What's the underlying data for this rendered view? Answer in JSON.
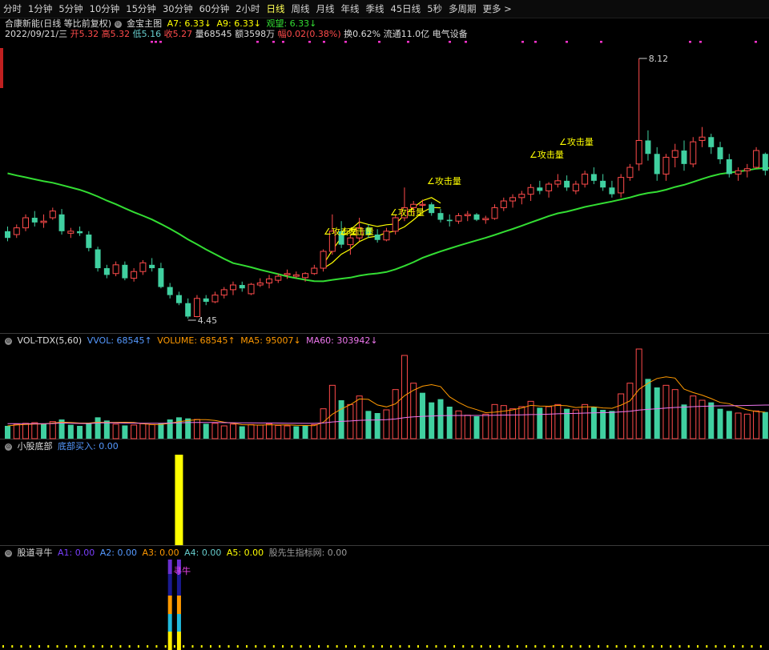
{
  "toolbar": {
    "tabs": [
      "分时",
      "1分钟",
      "5分钟",
      "10分钟",
      "15分钟",
      "30分钟",
      "60分钟",
      "2小时",
      "日线",
      "周线",
      "月线",
      "年线",
      "季线",
      "45日线",
      "5秒",
      "多周期",
      "更多 >"
    ],
    "active": "日线"
  },
  "header": {
    "stock": "合康新能(日线 等比前复权)",
    "indicator": "金宝主图",
    "a7": "A7: 6.33↓",
    "a9": "A9: 6.33↓",
    "guanwang": "观望: 6.33↓",
    "date": "2022/09/21/三",
    "open_label": "开",
    "open": "5.32",
    "high_label": "高",
    "high": "5.32",
    "low_label": "低",
    "low": "5.16",
    "close_label": "收",
    "close": "5.27",
    "vol_label": "量",
    "vol": "68545",
    "amount_label": "额",
    "amount": "3598万",
    "chg_label": "幅",
    "chg": "0.02(0.38%)",
    "turnover": "换0.62%",
    "float": "流通11.0亿",
    "industry": "电气设备"
  },
  "price_labels": {
    "high": "8.12",
    "low": "4.45"
  },
  "attack_label": "∠攻击量",
  "vol_pane": {
    "name": "VOL-TDX(5,60)",
    "vvol": "VVOL: 68545↑",
    "volume": "VOLUME: 68545↑",
    "ma5": "MA5: 95007↓",
    "ma60": "MA60: 303942↓"
  },
  "bottom_pane": {
    "name": "小股底部",
    "value": "底部买入: 0.00"
  },
  "niu_pane": {
    "name": "股道寻牛",
    "a1": "A1: 0.00",
    "a2": "A2: 0.00",
    "a3": "A3: 0.00",
    "a4": "A4: 0.00",
    "a5": "A5: 0.00",
    "site": "股先生指标网: 0.00",
    "marker": "寻牛"
  },
  "colors": {
    "up": "#ff4b4b",
    "down": "#40d0a0",
    "ma": "#33dd33",
    "yellow": "#ffff00",
    "ma5": "#ff9900",
    "ma60": "#ee77ee"
  },
  "chart_data": {
    "type": "candlestick",
    "ohlc": [
      [
        5.55,
        5.62,
        5.4,
        5.45
      ],
      [
        5.5,
        5.65,
        5.45,
        5.6
      ],
      [
        5.6,
        5.8,
        5.55,
        5.75
      ],
      [
        5.75,
        5.85,
        5.62,
        5.68
      ],
      [
        5.68,
        5.8,
        5.6,
        5.7
      ],
      [
        5.75,
        5.9,
        5.72,
        5.85
      ],
      [
        5.8,
        5.88,
        5.5,
        5.55
      ],
      [
        5.52,
        5.6,
        5.45,
        5.55
      ],
      [
        5.55,
        5.62,
        5.48,
        5.52
      ],
      [
        5.5,
        5.55,
        5.25,
        5.3
      ],
      [
        5.28,
        5.32,
        4.95,
        5.0
      ],
      [
        5.0,
        5.05,
        4.85,
        4.9
      ],
      [
        4.92,
        5.1,
        4.88,
        5.05
      ],
      [
        5.05,
        5.1,
        4.82,
        4.85
      ],
      [
        4.85,
        5.0,
        4.8,
        4.95
      ],
      [
        4.95,
        5.12,
        4.9,
        5.08
      ],
      [
        5.05,
        5.15,
        4.95,
        5.0
      ],
      [
        5.0,
        5.08,
        4.7,
        4.72
      ],
      [
        4.72,
        4.78,
        4.55,
        4.6
      ],
      [
        4.6,
        4.65,
        4.45,
        4.48
      ],
      [
        4.48,
        4.55,
        4.25,
        4.28
      ],
      [
        4.28,
        4.6,
        4.27,
        4.55
      ],
      [
        4.55,
        4.6,
        4.45,
        4.5
      ],
      [
        4.5,
        4.65,
        4.48,
        4.6
      ],
      [
        4.6,
        4.72,
        4.55,
        4.68
      ],
      [
        4.68,
        4.8,
        4.6,
        4.75
      ],
      [
        4.75,
        4.8,
        4.65,
        4.7
      ],
      [
        4.62,
        4.78,
        4.6,
        4.76
      ],
      [
        4.75,
        4.85,
        4.72,
        4.78
      ],
      [
        4.78,
        4.9,
        4.7,
        4.84
      ],
      [
        4.82,
        4.92,
        4.78,
        4.88
      ],
      [
        4.9,
        4.98,
        4.84,
        4.92
      ],
      [
        4.88,
        4.95,
        4.85,
        4.9
      ],
      [
        4.86,
        4.94,
        4.8,
        4.92
      ],
      [
        4.92,
        5.05,
        4.9,
        5.0
      ],
      [
        5.0,
        5.28,
        4.95,
        5.25
      ],
      [
        5.25,
        5.8,
        5.2,
        5.55
      ],
      [
        5.55,
        5.7,
        5.3,
        5.35
      ],
      [
        5.35,
        5.5,
        5.2,
        5.45
      ],
      [
        5.45,
        5.75,
        5.4,
        5.6
      ],
      [
        5.6,
        5.65,
        5.45,
        5.5
      ],
      [
        5.5,
        5.58,
        5.38,
        5.42
      ],
      [
        5.42,
        5.6,
        5.4,
        5.55
      ],
      [
        5.55,
        5.8,
        5.5,
        5.75
      ],
      [
        5.75,
        6.2,
        5.7,
        5.9
      ],
      [
        5.9,
        6.0,
        5.8,
        5.95
      ],
      [
        5.95,
        6.02,
        5.85,
        5.95
      ],
      [
        5.95,
        5.98,
        5.78,
        5.82
      ],
      [
        5.82,
        5.88,
        5.68,
        5.72
      ],
      [
        5.72,
        5.8,
        5.62,
        5.7
      ],
      [
        5.7,
        5.82,
        5.66,
        5.78
      ],
      [
        5.78,
        5.85,
        5.7,
        5.8
      ],
      [
        5.8,
        5.82,
        5.7,
        5.72
      ],
      [
        5.72,
        5.78,
        5.66,
        5.74
      ],
      [
        5.74,
        5.95,
        5.72,
        5.9
      ],
      [
        5.9,
        6.05,
        5.85,
        6.0
      ],
      [
        6.0,
        6.1,
        5.9,
        6.05
      ],
      [
        6.05,
        6.15,
        5.95,
        6.1
      ],
      [
        6.1,
        6.25,
        6.0,
        6.2
      ],
      [
        6.2,
        6.3,
        6.1,
        6.15
      ],
      [
        6.15,
        6.28,
        6.05,
        6.25
      ],
      [
        6.25,
        6.4,
        6.2,
        6.3
      ],
      [
        6.3,
        6.38,
        6.15,
        6.2
      ],
      [
        6.15,
        6.3,
        6.1,
        6.25
      ],
      [
        6.25,
        6.45,
        6.2,
        6.4
      ],
      [
        6.4,
        6.5,
        6.25,
        6.3
      ],
      [
        6.3,
        6.4,
        6.15,
        6.2
      ],
      [
        6.2,
        6.3,
        6.05,
        6.1
      ],
      [
        6.12,
        6.4,
        6.05,
        6.35
      ],
      [
        6.35,
        6.55,
        6.3,
        6.5
      ],
      [
        6.55,
        8.12,
        6.45,
        6.9
      ],
      [
        6.9,
        7.05,
        6.6,
        6.7
      ],
      [
        6.7,
        6.8,
        6.3,
        6.4
      ],
      [
        6.4,
        6.7,
        6.3,
        6.65
      ],
      [
        6.65,
        6.85,
        6.5,
        6.75
      ],
      [
        6.75,
        6.9,
        6.45,
        6.55
      ],
      [
        6.55,
        6.95,
        6.5,
        6.88
      ],
      [
        6.9,
        7.1,
        6.8,
        6.95
      ],
      [
        6.95,
        7.0,
        6.7,
        6.8
      ],
      [
        6.8,
        6.88,
        6.55,
        6.62
      ],
      [
        6.62,
        6.7,
        6.35,
        6.4
      ],
      [
        6.4,
        6.5,
        6.3,
        6.45
      ],
      [
        6.45,
        6.55,
        6.35,
        6.48
      ],
      [
        6.5,
        6.8,
        6.48,
        6.75
      ],
      [
        6.7,
        6.72,
        6.38,
        6.45
      ]
    ],
    "volume": [
      [
        60000,
        0
      ],
      [
        68000,
        1
      ],
      [
        72000,
        1
      ],
      [
        75000,
        1
      ],
      [
        70000,
        0
      ],
      [
        80000,
        1
      ],
      [
        90000,
        0
      ],
      [
        65000,
        0
      ],
      [
        60000,
        0
      ],
      [
        70000,
        0
      ],
      [
        100000,
        0
      ],
      [
        85000,
        0
      ],
      [
        68000,
        1
      ],
      [
        62000,
        0
      ],
      [
        64000,
        1
      ],
      [
        70000,
        1
      ],
      [
        66000,
        1
      ],
      [
        72000,
        0
      ],
      [
        90000,
        0
      ],
      [
        100000,
        0
      ],
      [
        95000,
        0
      ],
      [
        90000,
        1
      ],
      [
        70000,
        0
      ],
      [
        72000,
        1
      ],
      [
        60000,
        1
      ],
      [
        68000,
        1
      ],
      [
        58000,
        0
      ],
      [
        66000,
        1
      ],
      [
        64000,
        1
      ],
      [
        70000,
        1
      ],
      [
        62000,
        1
      ],
      [
        60000,
        1
      ],
      [
        58000,
        0
      ],
      [
        60000,
        0
      ],
      [
        66000,
        1
      ],
      [
        140000,
        1
      ],
      [
        250000,
        1
      ],
      [
        180000,
        0
      ],
      [
        160000,
        1
      ],
      [
        200000,
        1
      ],
      [
        130000,
        0
      ],
      [
        120000,
        0
      ],
      [
        135000,
        1
      ],
      [
        230000,
        1
      ],
      [
        390000,
        1
      ],
      [
        260000,
        1
      ],
      [
        215000,
        0
      ],
      [
        170000,
        0
      ],
      [
        185000,
        0
      ],
      [
        150000,
        0
      ],
      [
        130000,
        1
      ],
      [
        110000,
        1
      ],
      [
        105000,
        0
      ],
      [
        115000,
        1
      ],
      [
        160000,
        1
      ],
      [
        155000,
        1
      ],
      [
        140000,
        1
      ],
      [
        150000,
        1
      ],
      [
        175000,
        1
      ],
      [
        145000,
        0
      ],
      [
        150000,
        1
      ],
      [
        160000,
        1
      ],
      [
        140000,
        0
      ],
      [
        135000,
        1
      ],
      [
        160000,
        1
      ],
      [
        150000,
        0
      ],
      [
        135000,
        0
      ],
      [
        130000,
        0
      ],
      [
        210000,
        1
      ],
      [
        260000,
        1
      ],
      [
        420000,
        1
      ],
      [
        280000,
        0
      ],
      [
        240000,
        0
      ],
      [
        250000,
        1
      ],
      [
        230000,
        1
      ],
      [
        160000,
        0
      ],
      [
        200000,
        1
      ],
      [
        180000,
        1
      ],
      [
        170000,
        0
      ],
      [
        140000,
        0
      ],
      [
        130000,
        0
      ],
      [
        120000,
        1
      ],
      [
        115000,
        1
      ],
      [
        130000,
        1
      ],
      [
        125000,
        0
      ]
    ],
    "ylim_price": [
      4.25,
      8.12
    ],
    "ylim_volume": [
      0,
      420000
    ]
  }
}
